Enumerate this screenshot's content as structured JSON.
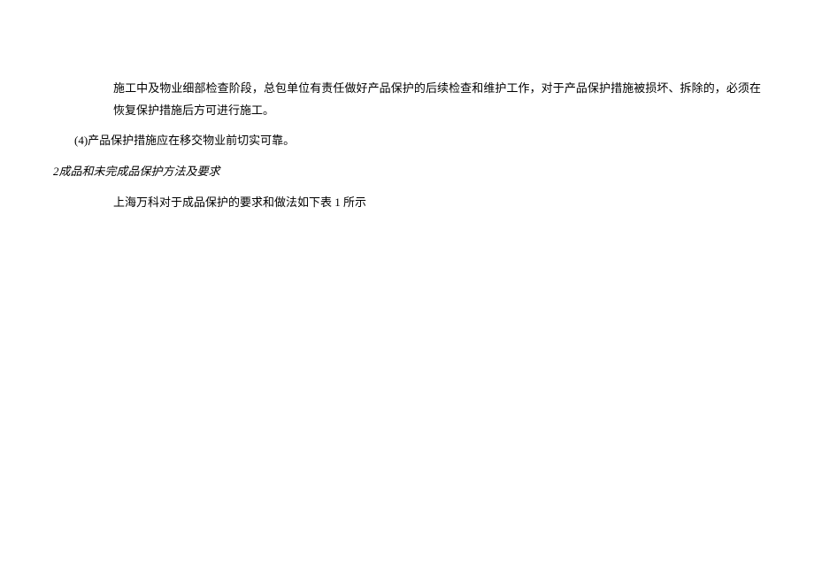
{
  "doc": {
    "p1": "施工中及物业细部检查阶段，总包单位有责任做好产品保护的后续检查和维护工作，对于产品保护措施被损坏、拆除的，必须在恢复保护措施后方可进行施工。",
    "p2": "(4)产品保护措施应在移交物业前切实可靠。",
    "p3_num": "2",
    "p3_text": "成品和未完成品保护方法及要求",
    "p4": "上海万科对于成品保护的要求和做法如下表 1 所示"
  }
}
